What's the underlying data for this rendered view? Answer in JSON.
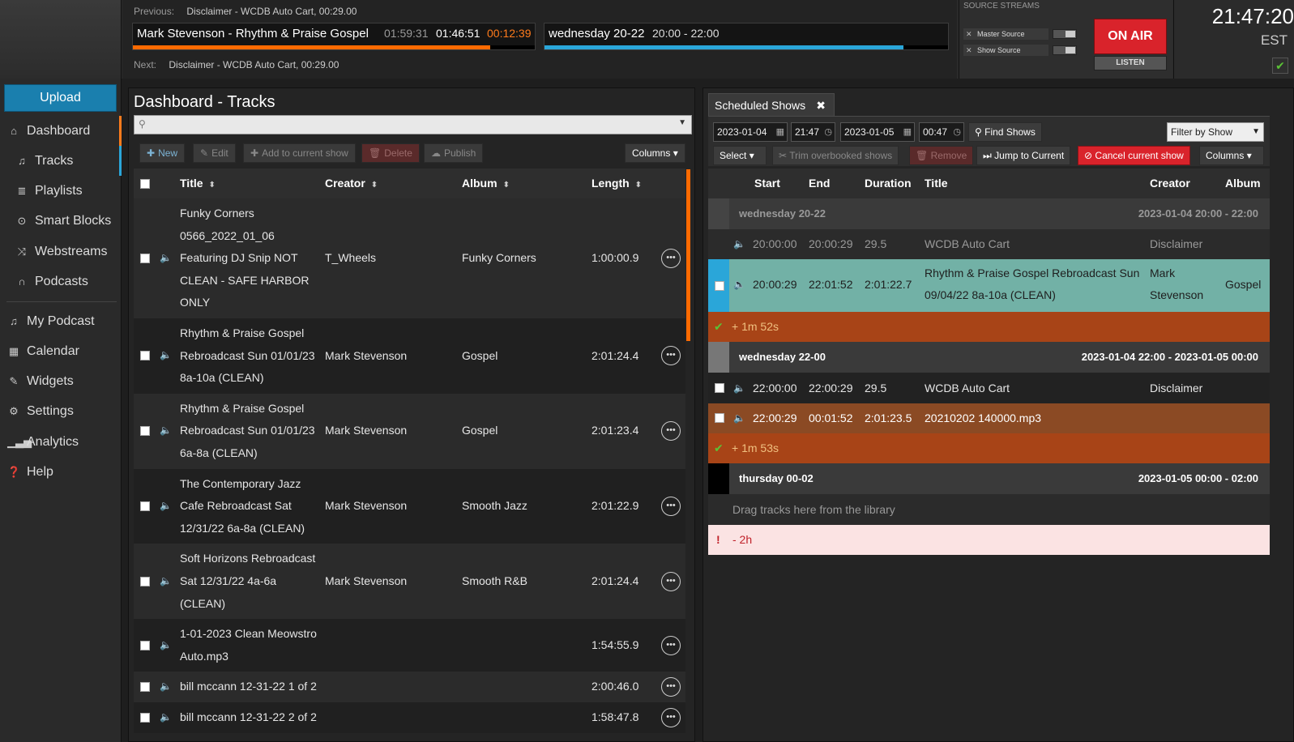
{
  "header": {
    "previous_label": "Previous:",
    "previous_value": "Disclaimer - WCDB Auto Cart, 00:29.00",
    "next_label": "Next:",
    "next_value": "Disclaimer - WCDB Auto Cart, 00:29.00",
    "current_track": "Mark Stevenson - Rhythm & Praise Gospel",
    "track_length": "01:59:31",
    "track_elapsed": "01:46:51",
    "track_remaining": "00:12:39",
    "track_progress_pct": 89,
    "current_show": "wednesday 20-22",
    "show_time": "20:00 - 22:00",
    "show_progress_pct": 89,
    "source_streams_label": "SOURCE STREAMS",
    "master_source": "Master Source",
    "show_source": "Show Source",
    "on_air": "ON AIR",
    "listen": "LISTEN",
    "clock": "21:47:20",
    "timezone": "EST",
    "status_icon": "check-icon"
  },
  "sidebar": {
    "upload": "Upload",
    "items": [
      {
        "label": "Dashboard",
        "icon": "home-icon"
      },
      {
        "label": "Tracks",
        "icon": "music-note-icon"
      },
      {
        "label": "Playlists",
        "icon": "list-icon"
      },
      {
        "label": "Smart Blocks",
        "icon": "smart-block-icon"
      },
      {
        "label": "Webstreams",
        "icon": "shuffle-icon"
      },
      {
        "label": "Podcasts",
        "icon": "headphones-icon"
      },
      {
        "label": "My Podcast",
        "icon": "music-note-icon"
      },
      {
        "label": "Calendar",
        "icon": "calendar-icon"
      },
      {
        "label": "Widgets",
        "icon": "wrench-icon"
      },
      {
        "label": "Settings",
        "icon": "gear-icon"
      },
      {
        "label": "Analytics",
        "icon": "bar-chart-icon"
      },
      {
        "label": "Help",
        "icon": "help-icon"
      }
    ]
  },
  "tracks": {
    "title": "Dashboard - Tracks",
    "search_placeholder": "",
    "toolbar": {
      "new": "New",
      "edit": "Edit",
      "add": "Add to current show",
      "delete": "Delete",
      "publish": "Publish",
      "columns": "Columns"
    },
    "columns": [
      "Title",
      "Creator",
      "Album",
      "Length"
    ],
    "rows": [
      {
        "title": "Funky Corners 0566_2022_01_06 Featuring DJ Snip NOT CLEAN - SAFE HARBOR ONLY",
        "lines": [
          "Funky Corners",
          "0566_2022_01_06",
          "Featuring DJ Snip NOT",
          "CLEAN - SAFE HARBOR",
          "ONLY"
        ],
        "creator": "T_Wheels",
        "album": "Funky Corners",
        "length": "1:00:00.9"
      },
      {
        "lines": [
          "Rhythm & Praise Gospel",
          "Rebroadcast Sun 01/01/23",
          "8a-10a (CLEAN)"
        ],
        "creator": "Mark Stevenson",
        "album": "Gospel",
        "length": "2:01:24.4"
      },
      {
        "lines": [
          "Rhythm & Praise Gospel",
          "Rebroadcast Sun 01/01/23",
          "6a-8a (CLEAN)"
        ],
        "creator": "Mark Stevenson",
        "album": "Gospel",
        "length": "2:01:23.4"
      },
      {
        "lines": [
          "The Contemporary Jazz",
          "Cafe Rebroadcast Sat",
          "12/31/22 6a-8a (CLEAN)"
        ],
        "creator": "Mark Stevenson",
        "album": "Smooth Jazz",
        "length": "2:01:22.9"
      },
      {
        "lines": [
          "Soft Horizons Rebroadcast",
          "Sat 12/31/22 4a-6a",
          "(CLEAN)"
        ],
        "creator": "Mark Stevenson",
        "album": "Smooth R&B",
        "length": "2:01:24.4"
      },
      {
        "lines": [
          "1-01-2023 Clean Meowstro",
          "Auto.mp3"
        ],
        "creator": "",
        "album": "",
        "length": "1:54:55.9"
      },
      {
        "lines": [
          "bill mccann 12-31-22 1 of 2"
        ],
        "creator": "",
        "album": "",
        "length": "2:00:46.0"
      },
      {
        "lines": [
          "bill mccann 12-31-22 2 of 2"
        ],
        "creator": "",
        "album": "",
        "length": "1:58:47.8"
      }
    ]
  },
  "shows": {
    "tab": "Scheduled Shows",
    "start_date": "2023-01-04",
    "start_time": "21:47",
    "end_date": "2023-01-05",
    "end_time": "00:47",
    "find_shows": "Find Shows",
    "filter": "Filter by Show",
    "select": "Select",
    "trim": "Trim overbooked shows",
    "remove": "Remove",
    "jump": "Jump to Current",
    "cancel": "Cancel current show",
    "columns_btn": "Columns",
    "columns": [
      "Start",
      "End",
      "Duration",
      "Title",
      "Creator",
      "Album"
    ],
    "group1": {
      "name": "wednesday 20-22",
      "range": "2023-01-04 20:00 - 22:00"
    },
    "row1": {
      "start": "20:00:00",
      "end": "20:00:29",
      "duration": "29.5",
      "title": "WCDB Auto Cart",
      "creator": "Disclaimer"
    },
    "row2": {
      "start": "20:00:29",
      "end": "22:01:52",
      "duration": "2:01:22.7",
      "title_l1": "Rhythm & Praise Gospel Rebroadcast Sun",
      "title_l2": "09/04/22 8a-10a (CLEAN)",
      "creator_l1": "Mark",
      "creator_l2": "Stevenson",
      "album": "Gospel"
    },
    "gap1": "+ 1m 52s",
    "group2": {
      "name": "wednesday 22-00",
      "range": "2023-01-04 22:00 - 2023-01-05 00:00"
    },
    "row3": {
      "start": "22:00:00",
      "end": "22:00:29",
      "duration": "29.5",
      "title": "WCDB Auto Cart",
      "creator": "Disclaimer"
    },
    "row4": {
      "start": "22:00:29",
      "end": "00:01:52",
      "duration": "2:01:23.5",
      "title": "20210202 140000.mp3"
    },
    "gap2": "+ 1m 53s",
    "group3": {
      "name": "thursday 00-02",
      "range": "2023-01-05 00:00 - 02:00"
    },
    "empty": "Drag tracks here from the library",
    "under": "- 2h"
  }
}
